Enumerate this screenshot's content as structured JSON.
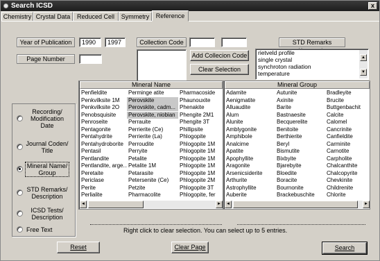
{
  "window": {
    "title": "Search ICSD",
    "close_glyph": "x"
  },
  "tabs": [
    "Chemistry",
    "Crystal Data",
    "Reduced Cell",
    "Symmetry",
    "Reference"
  ],
  "reference": {
    "year_label": "Year of Publication",
    "year_from": "1990",
    "year_to": "1997",
    "page_label": "Page Number",
    "page_value": "",
    "collection_label": "Collection Code",
    "collection_1": "",
    "collection_2": "",
    "add_collection_button": "Add Collecion Code",
    "clear_selection_button": "Clear Selection",
    "std_keywords_label": "STD Remarks Keywords",
    "keywords": [
      "rietveld profile",
      "single crystal",
      "synchroton radiation",
      "temperature"
    ]
  },
  "search_type": {
    "options": [
      {
        "label": "Recording/ Modification Date",
        "checked": false
      },
      {
        "label": "Journal Coden/ Title",
        "checked": false
      },
      {
        "label": "Mineral Name/ Group",
        "checked": true
      },
      {
        "label": "STD Remarks/ Description",
        "checked": false
      },
      {
        "label": "ICSD Tests/ Description",
        "checked": false
      },
      {
        "label": "Free Text",
        "checked": false
      }
    ]
  },
  "mineral_name": {
    "header": "Mineral Name",
    "columns": [
      [
        "Penfieldite",
        "Penkvilksite 1M",
        "Penkvilksite 2O",
        "Penobsquisite",
        "Penroseite",
        "Pentagonite",
        "Pentahydrite",
        "Pentahydroborite",
        "Pentasil",
        "Pentlandite",
        "Pentlandite, arge...",
        "Peretaite",
        "Periclase",
        "Perite",
        "Perlialite"
      ],
      [
        "Perminge atite",
        "Perovskite",
        "Perovskite, cadm...",
        "Perovskite, niobian",
        "Perrauite",
        "Perrierite (Ce)",
        "Perrierite (La)",
        "Perroudite",
        "Perryite",
        "Petalite",
        "Petalite 1M",
        "Petarasite",
        "Petersenite (Ce)",
        "Petzite",
        "Pharmacolite"
      ],
      [
        "Pharmacoside",
        "Phaunouxite",
        "Phenakite",
        "Phengite 2M1",
        "Phengite 3T",
        "Phillipsite",
        "Phlogopite",
        "Phlogopite 1M",
        "Phlogopite 1M",
        "Phlogopite 1M",
        "Phlogopite 1M",
        "Phlogopite 1M",
        "Phlogopite 2M",
        "Phlogopite 3T",
        "Phlogopite, fer"
      ]
    ],
    "highlighted": [
      "Perovskite",
      "Perovskite, cadm...",
      "Perovskite, niobian"
    ]
  },
  "mineral_group": {
    "header": "Mineral Group",
    "columns": [
      [
        "Adamite",
        "Aenigmatite",
        "Alluaudite",
        "Alum",
        "Alunite",
        "Amblygonite",
        "Amphibole",
        "Analcime",
        "Apatite",
        "Apophyllite",
        "Aragonite",
        "Arsenicsiderite",
        "Arthurite",
        "Astrophyllite",
        "Auberite"
      ],
      [
        "Autunite",
        "Axinite",
        "Barite",
        "Bastnaesite",
        "Becquerelite",
        "Benitoite",
        "Berthierite",
        "Beryl",
        "Bismutite",
        "Bixbyite",
        "Bjarebyite",
        "Bloedite",
        "Boracite",
        "Bournonite",
        "Brackebuschite"
      ],
      [
        "Bradleyite",
        "Brucite",
        "Buttgenbachit",
        "Calcite",
        "Calomel",
        "Cancrinite",
        "Canfieldite",
        "Carminite",
        "Carnotite",
        "Carpholite",
        "Chalcanthite",
        "Chalcopyrite",
        "Chevkinite",
        "Childrenite",
        "Chlorite"
      ]
    ]
  },
  "hint_text": "Right click to clear selection. You can select up to 5 entries.",
  "buttons": {
    "reset": "Reset",
    "clear_page": "Clear Page",
    "search": "Search"
  }
}
